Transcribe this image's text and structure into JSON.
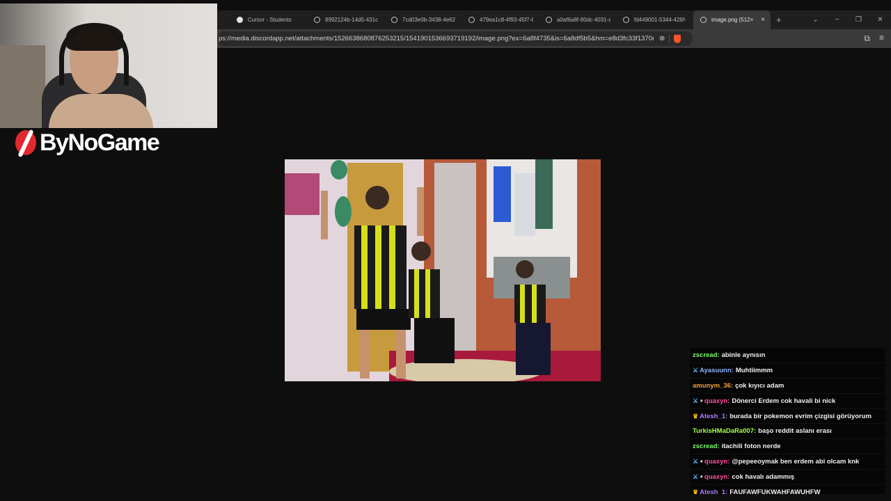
{
  "browser": {
    "tabs": [
      {
        "label": "Cursor - Students",
        "icon": "cursor-logo-icon",
        "active": false
      },
      {
        "label": "8992124b-14d5-431c",
        "icon": "globe-icon",
        "active": false
      },
      {
        "label": "7cd03e0b-3438-4e62",
        "icon": "globe-icon",
        "active": false
      },
      {
        "label": "479ea1c8-4f93-45f7-8",
        "icon": "globe-icon",
        "active": false
      },
      {
        "label": "a0af6a8f-80dc-4031-a",
        "icon": "globe-icon",
        "active": false
      },
      {
        "label": "fd449001-5344-426f-",
        "icon": "globe-icon",
        "active": false
      },
      {
        "label": "image.png (512×",
        "icon": "globe-icon",
        "active": true
      }
    ],
    "new_tab": "+",
    "close_tab": "×",
    "window_controls": {
      "dropdown": "⌄",
      "minimize": "−",
      "restore": "❐",
      "close": "✕"
    },
    "url": "ps://media.discordapp.net/attachments/1526638680876253215/1541901536693719192/image.png?ex=6a8f4735&is=6a8df5b5&hm=e8d3fc33f1370e...",
    "brave_color": "#fb542b"
  },
  "overlay": {
    "brand": "ByNoGame",
    "brand_color": "#e1282f"
  },
  "chat": {
    "messages": [
      {
        "badges": [],
        "user": "zscread:",
        "user_color": "#7cff6b",
        "text": "abinle aynısın"
      },
      {
        "badges": [
          "sword"
        ],
        "user": "Ayasuunn:",
        "user_color": "#8fb4ff",
        "text": "Muhtiimmm"
      },
      {
        "badges": [],
        "user": "amunym_36:",
        "user_color": "#f0a23c",
        "text": "çok kıyıcı adam"
      },
      {
        "badges": [
          "sword",
          "ghost"
        ],
        "user": "quaxyn:",
        "user_color": "#ff4fa0",
        "text": "Dönerci Erdem cok havali bi nick"
      },
      {
        "badges": [
          "crown"
        ],
        "user": "Atesh_1:",
        "user_color": "#b07cff",
        "text": "burada bir pokemon evrim çizgisi görüyorum"
      },
      {
        "badges": [],
        "user": "TurkisHMaDaRa007:",
        "user_color": "#a6ff4a",
        "text": "başo reddit aslanı erası"
      },
      {
        "badges": [],
        "user": "zscread:",
        "user_color": "#7cff6b",
        "text": "itachili foton nerde"
      },
      {
        "badges": [
          "sword",
          "ghost"
        ],
        "user": "quaxyn:",
        "user_color": "#ff4fa0",
        "text": "@pepeeoymak ben erdem abi olcam knk"
      },
      {
        "badges": [
          "sword",
          "ghost"
        ],
        "user": "quaxyn:",
        "user_color": "#ff4fa0",
        "text": "cok havalı adammış"
      },
      {
        "badges": [
          "crown"
        ],
        "user": "Atesh_1:",
        "user_color": "#b07cff",
        "text": "FAUFAWFUKWAHFAWUHFW"
      }
    ]
  }
}
